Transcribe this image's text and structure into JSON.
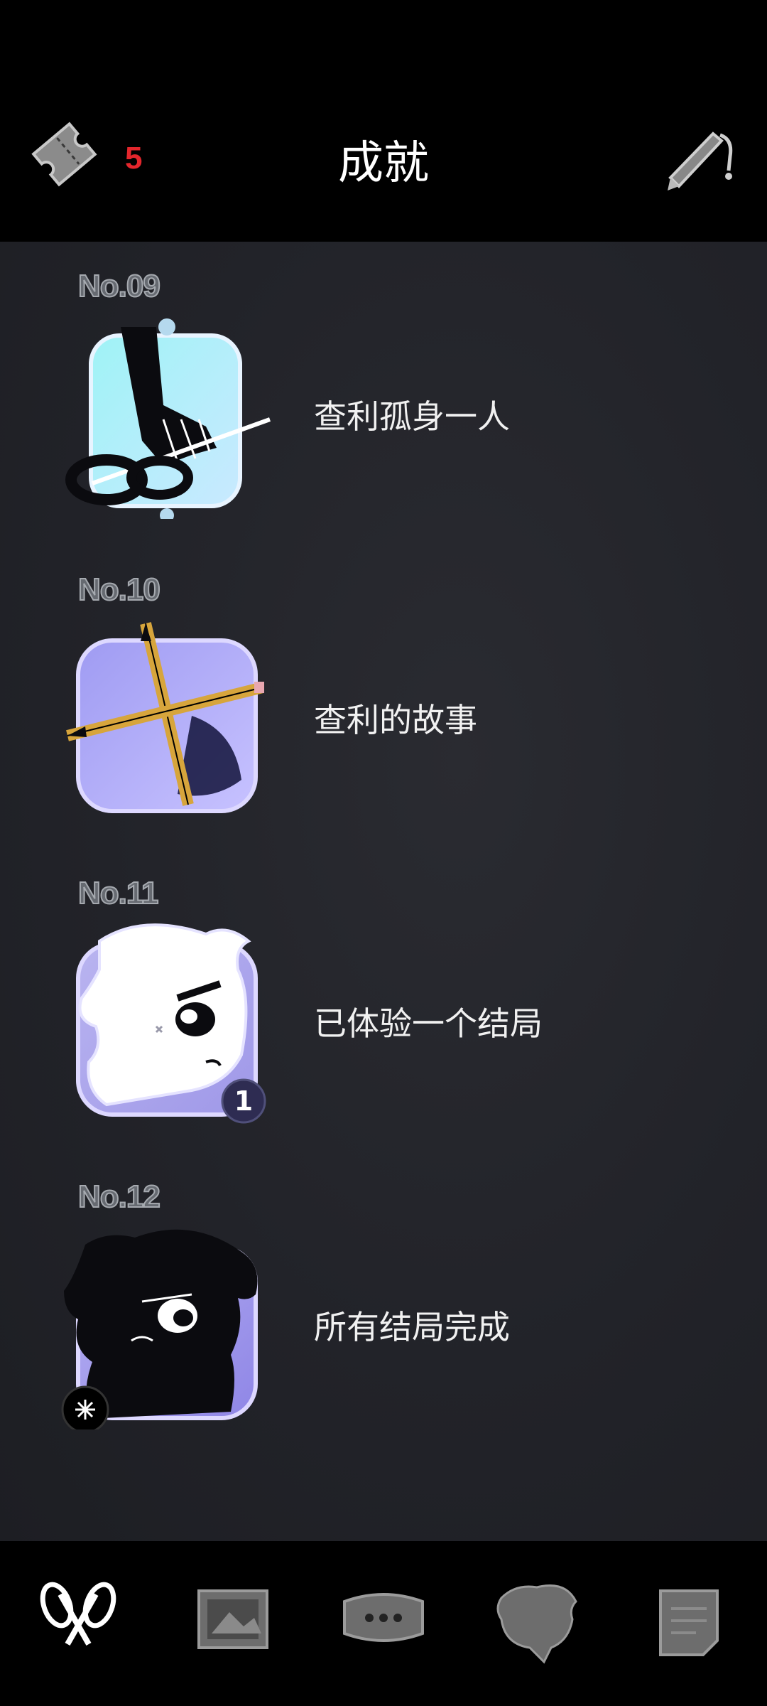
{
  "header": {
    "title": "成就",
    "ticket_count": "5",
    "ticket_icon": "ticket-icon",
    "pen_icon": "pen-icon"
  },
  "achievements": [
    {
      "no": "No.09",
      "label": "查利孤身一人",
      "icon": "hand-scissors-icon"
    },
    {
      "no": "No.10",
      "label": "查利的故事",
      "icon": "crossed-pencils-icon"
    },
    {
      "no": "No.11",
      "label": "已体验一个结局",
      "icon": "white-character-icon",
      "badge": "1"
    },
    {
      "no": "No.12",
      "label": "所有结局完成",
      "icon": "black-character-icon"
    }
  ],
  "bottom_nav": [
    {
      "name": "scissors-tab",
      "icon": "scissors-icon",
      "active": true
    },
    {
      "name": "gallery-tab",
      "icon": "gallery-icon",
      "active": false
    },
    {
      "name": "dialogue-tab",
      "icon": "dialogue-icon",
      "active": false
    },
    {
      "name": "character-tab",
      "icon": "character-icon",
      "active": false
    },
    {
      "name": "notes-tab",
      "icon": "notes-icon",
      "active": false
    }
  ],
  "colors": {
    "accent_red": "#e3262c",
    "background": "#222329",
    "nav_inactive": "#6d6d6d"
  }
}
